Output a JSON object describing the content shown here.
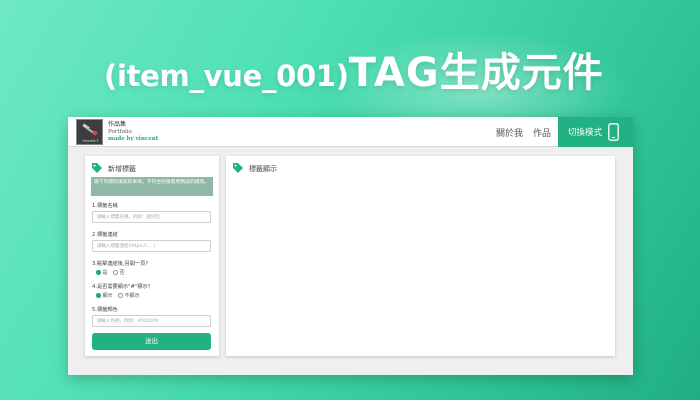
{
  "banner": {
    "title_prefix": "(item_vue_001)",
    "title_main": "TAG生成元件"
  },
  "header": {
    "logo_caption": "Vincent.T",
    "brand_line1": "作品集",
    "brand_line2": "Portfolio",
    "brand_line3": "made by vincent",
    "nav_about": "關於我",
    "nav_works": "作品",
    "switch_label": "切換模式"
  },
  "form": {
    "title": "新增標籤",
    "note": "請下列資料填寫的事項，不符合則會套用預設的樣貌。",
    "q1_label": "1.標籤名稱",
    "q1_placeholder": "請輸入標籤名稱，例如：超好吃",
    "q2_label": "2.標籤連結",
    "q2_placeholder": "請輸入標籤連結(https://.....)",
    "q3_label": "3.點擊連結後,另開一頁？",
    "q3_options": [
      "是",
      "否"
    ],
    "q4_label": "4.是否需要顯示\"#\"標示？",
    "q4_options": [
      "顯示",
      "不顯示"
    ],
    "q5_label": "5.標籤顏色",
    "q5_placeholder": "請輸入色碼，例如：#000000",
    "submit_label": "送出"
  },
  "display": {
    "title": "標籤顯示"
  },
  "colors": {
    "accent": "#21b183",
    "note_bg": "#8fb8a7",
    "background_gradient": [
      "#6fe8c6",
      "#1fae83"
    ]
  },
  "icons": {
    "logo": "hammer-wrench-icon",
    "switch": "phone-icon",
    "section": "tag-icon"
  }
}
